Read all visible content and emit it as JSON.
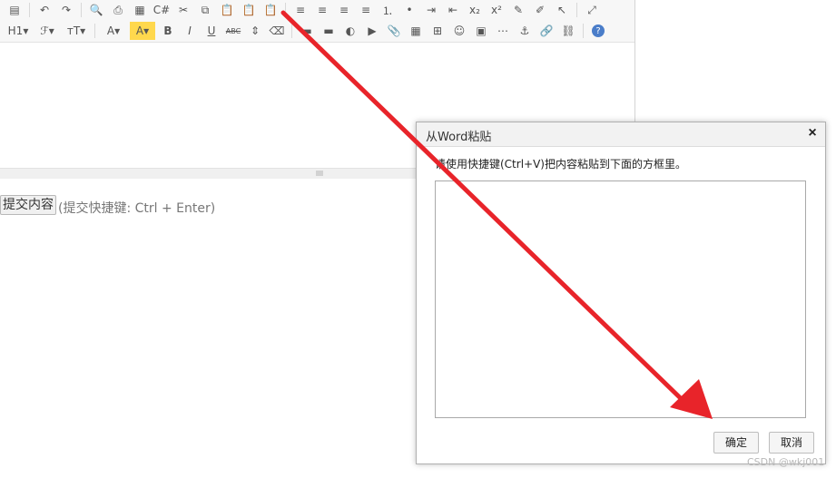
{
  "toolbar": {
    "row1": [
      {
        "name": "source-icon",
        "glyph": "▤"
      },
      {
        "sep": true
      },
      {
        "name": "undo-icon",
        "glyph": "↶"
      },
      {
        "name": "redo-icon",
        "glyph": "↷"
      },
      {
        "sep": true
      },
      {
        "name": "preview-icon",
        "glyph": "🔍"
      },
      {
        "name": "print-icon",
        "glyph": "⎙"
      },
      {
        "name": "template-icon",
        "glyph": "▦"
      },
      {
        "name": "code-icon",
        "glyph": "C#"
      },
      {
        "name": "cut-icon",
        "glyph": "✂"
      },
      {
        "name": "copy-icon",
        "glyph": "⧉"
      },
      {
        "name": "paste-icon",
        "glyph": "📋"
      },
      {
        "name": "paste-plain-icon",
        "glyph": "📋"
      },
      {
        "name": "paste-word-icon",
        "glyph": "📋"
      },
      {
        "sep": true
      },
      {
        "name": "align-left-icon",
        "glyph": "≡"
      },
      {
        "name": "align-center-icon",
        "glyph": "≡"
      },
      {
        "name": "align-right-icon",
        "glyph": "≡"
      },
      {
        "name": "align-justify-icon",
        "glyph": "≡"
      },
      {
        "name": "ordered-list-icon",
        "glyph": "⒈"
      },
      {
        "name": "unordered-list-icon",
        "glyph": "•"
      },
      {
        "name": "indent-icon",
        "glyph": "⇥"
      },
      {
        "name": "outdent-icon",
        "glyph": "⇤"
      },
      {
        "name": "subscript-icon",
        "glyph": "x₂"
      },
      {
        "name": "superscript-icon",
        "glyph": "x²"
      },
      {
        "name": "clear-format-icon",
        "glyph": "✎"
      },
      {
        "name": "quick-format-icon",
        "glyph": "✐"
      },
      {
        "name": "select-all-icon",
        "glyph": "↖"
      },
      {
        "sep": true
      },
      {
        "name": "fullscreen-icon",
        "glyph": "⤢"
      }
    ],
    "row2": [
      {
        "name": "heading-dropdown",
        "glyph": "H1▾",
        "wide": true
      },
      {
        "name": "font-family-dropdown",
        "glyph": "ℱ▾",
        "wide": true
      },
      {
        "name": "font-size-dropdown",
        "glyph": "ᴛT▾",
        "wide": true
      },
      {
        "sep": true
      },
      {
        "name": "font-color-dropdown",
        "glyph": "A▾",
        "wide": true
      },
      {
        "name": "highlight-color-dropdown",
        "glyph": "A▾",
        "wide": true
      },
      {
        "name": "bold-icon",
        "glyph": "B"
      },
      {
        "name": "italic-icon",
        "glyph": "I"
      },
      {
        "name": "underline-icon",
        "glyph": "U"
      },
      {
        "name": "strikethrough-icon",
        "glyph": "ABC"
      },
      {
        "name": "line-height-icon",
        "glyph": "⇕"
      },
      {
        "name": "eraser-icon",
        "glyph": "⌫"
      },
      {
        "sep": true
      },
      {
        "name": "horizontal-rule-icon",
        "glyph": "▬"
      },
      {
        "name": "anchor-line-icon",
        "glyph": "▬"
      },
      {
        "name": "flash-icon",
        "glyph": "◐"
      },
      {
        "name": "media-icon",
        "glyph": "▶"
      },
      {
        "name": "attachment-icon",
        "glyph": "📎"
      },
      {
        "name": "table-icon",
        "glyph": "▦"
      },
      {
        "name": "insert-row-icon",
        "glyph": "⊞"
      },
      {
        "name": "emoticon-icon",
        "glyph": "☺"
      },
      {
        "name": "image-icon",
        "glyph": "▣"
      },
      {
        "name": "page-break-icon",
        "glyph": "⋯"
      },
      {
        "name": "anchor-icon",
        "glyph": "⚓"
      },
      {
        "name": "link-icon",
        "glyph": "🔗"
      },
      {
        "name": "unlink-icon",
        "glyph": "⛓"
      },
      {
        "sep": true
      },
      {
        "name": "help-icon",
        "glyph": "?"
      }
    ]
  },
  "editor": {
    "submit_label": "提交内容",
    "submit_hint": "(提交快捷键: Ctrl + Enter)"
  },
  "dialog": {
    "title": "从Word粘贴",
    "close_glyph": "×",
    "instruction": "请使用快捷键(Ctrl+V)把内容粘贴到下面的方框里。",
    "ok_label": "确定",
    "cancel_label": "取消"
  },
  "watermark": "CSDN @wkj001",
  "colors": {
    "arrow": "#e8242a",
    "highlight": "#ffd84d"
  }
}
